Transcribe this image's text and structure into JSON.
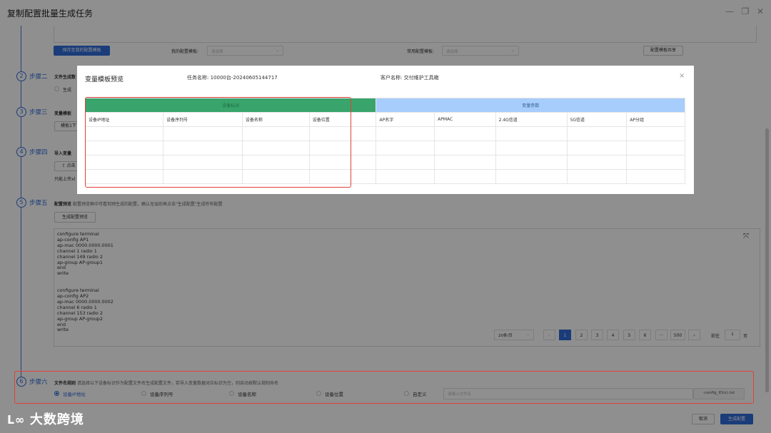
{
  "window": {
    "title": "复制配置批量生成任务"
  },
  "top": {
    "save_btn": "保存至我的配置模板",
    "my_template_label": "我的配置模板:",
    "my_template_placeholder": "请选择",
    "common_template_label": "常用配置模板:",
    "common_template_placeholder": "请选择",
    "share_btn": "配置模板共享"
  },
  "steps": {
    "s2": {
      "num": "2",
      "label": "步骤二",
      "title": "文件生成数",
      "opt": "生成"
    },
    "s3": {
      "num": "3",
      "label": "步骤三",
      "title": "变量模板",
      "btn": "模板1下"
    },
    "s4": {
      "num": "4",
      "label": "步骤四",
      "title": "导入变量",
      "btn": "点击",
      "hint": "只能上传xl"
    },
    "s5": {
      "num": "5",
      "label": "步骤五",
      "title": "配置预览",
      "desc": "配置预览框中可看到预生成的配置，确认无误后再点击\"生成配置\"生成所有配置",
      "btn": "生成配置预览"
    },
    "s6": {
      "num": "6",
      "label": "步骤六",
      "title": "文件名规则",
      "desc": "请选择以下设备标识作为配置文件名生成配置文件，若导入变量数据对应标识为空，则自动按默认规则命名"
    }
  },
  "preview_text": "configure terminal\nap-config AP1\nap-mac 0000.0000.0001\nchannel 1 radio 1\nchannel 149 radio 2\nap-group AP-group1\nend\nwrite\n\n\nconfigure terminal\nap-config AP2\nap-mac 0000.0000.0002\nchannel 6 radio 1\nchannel 153 radio 2\nap-group AP-group2\nend\nwrite",
  "pagination": {
    "page_size": "20条/页",
    "pages": [
      "1",
      "2",
      "3",
      "4",
      "5",
      "6",
      "···",
      "500"
    ],
    "goto_label": "前往",
    "goto_value": "1",
    "page_unit": "页"
  },
  "naming": {
    "options": [
      "设备IP地址",
      "设备序列号",
      "设备名称",
      "设备位置",
      "自定义"
    ],
    "placeholder": "请输入文件名",
    "suffix": "-config_ID(x).txt"
  },
  "footer": {
    "cancel": "取消",
    "generate": "生成配置"
  },
  "watermark": "大数跨境",
  "modal": {
    "title": "变量模板预览",
    "task_label": "任务名称:",
    "task_value": "10000台-20240605144717",
    "customer_label": "客户名称:",
    "customer_value": "交付维护工具箱",
    "group_device": "设备标识",
    "group_vars": "变量参数",
    "columns": [
      "设备IP地址",
      "设备序列号",
      "设备名称",
      "设备位置",
      "AP名字",
      "APMAC",
      "2.4G信道",
      "5G信道",
      "AP分组"
    ]
  }
}
